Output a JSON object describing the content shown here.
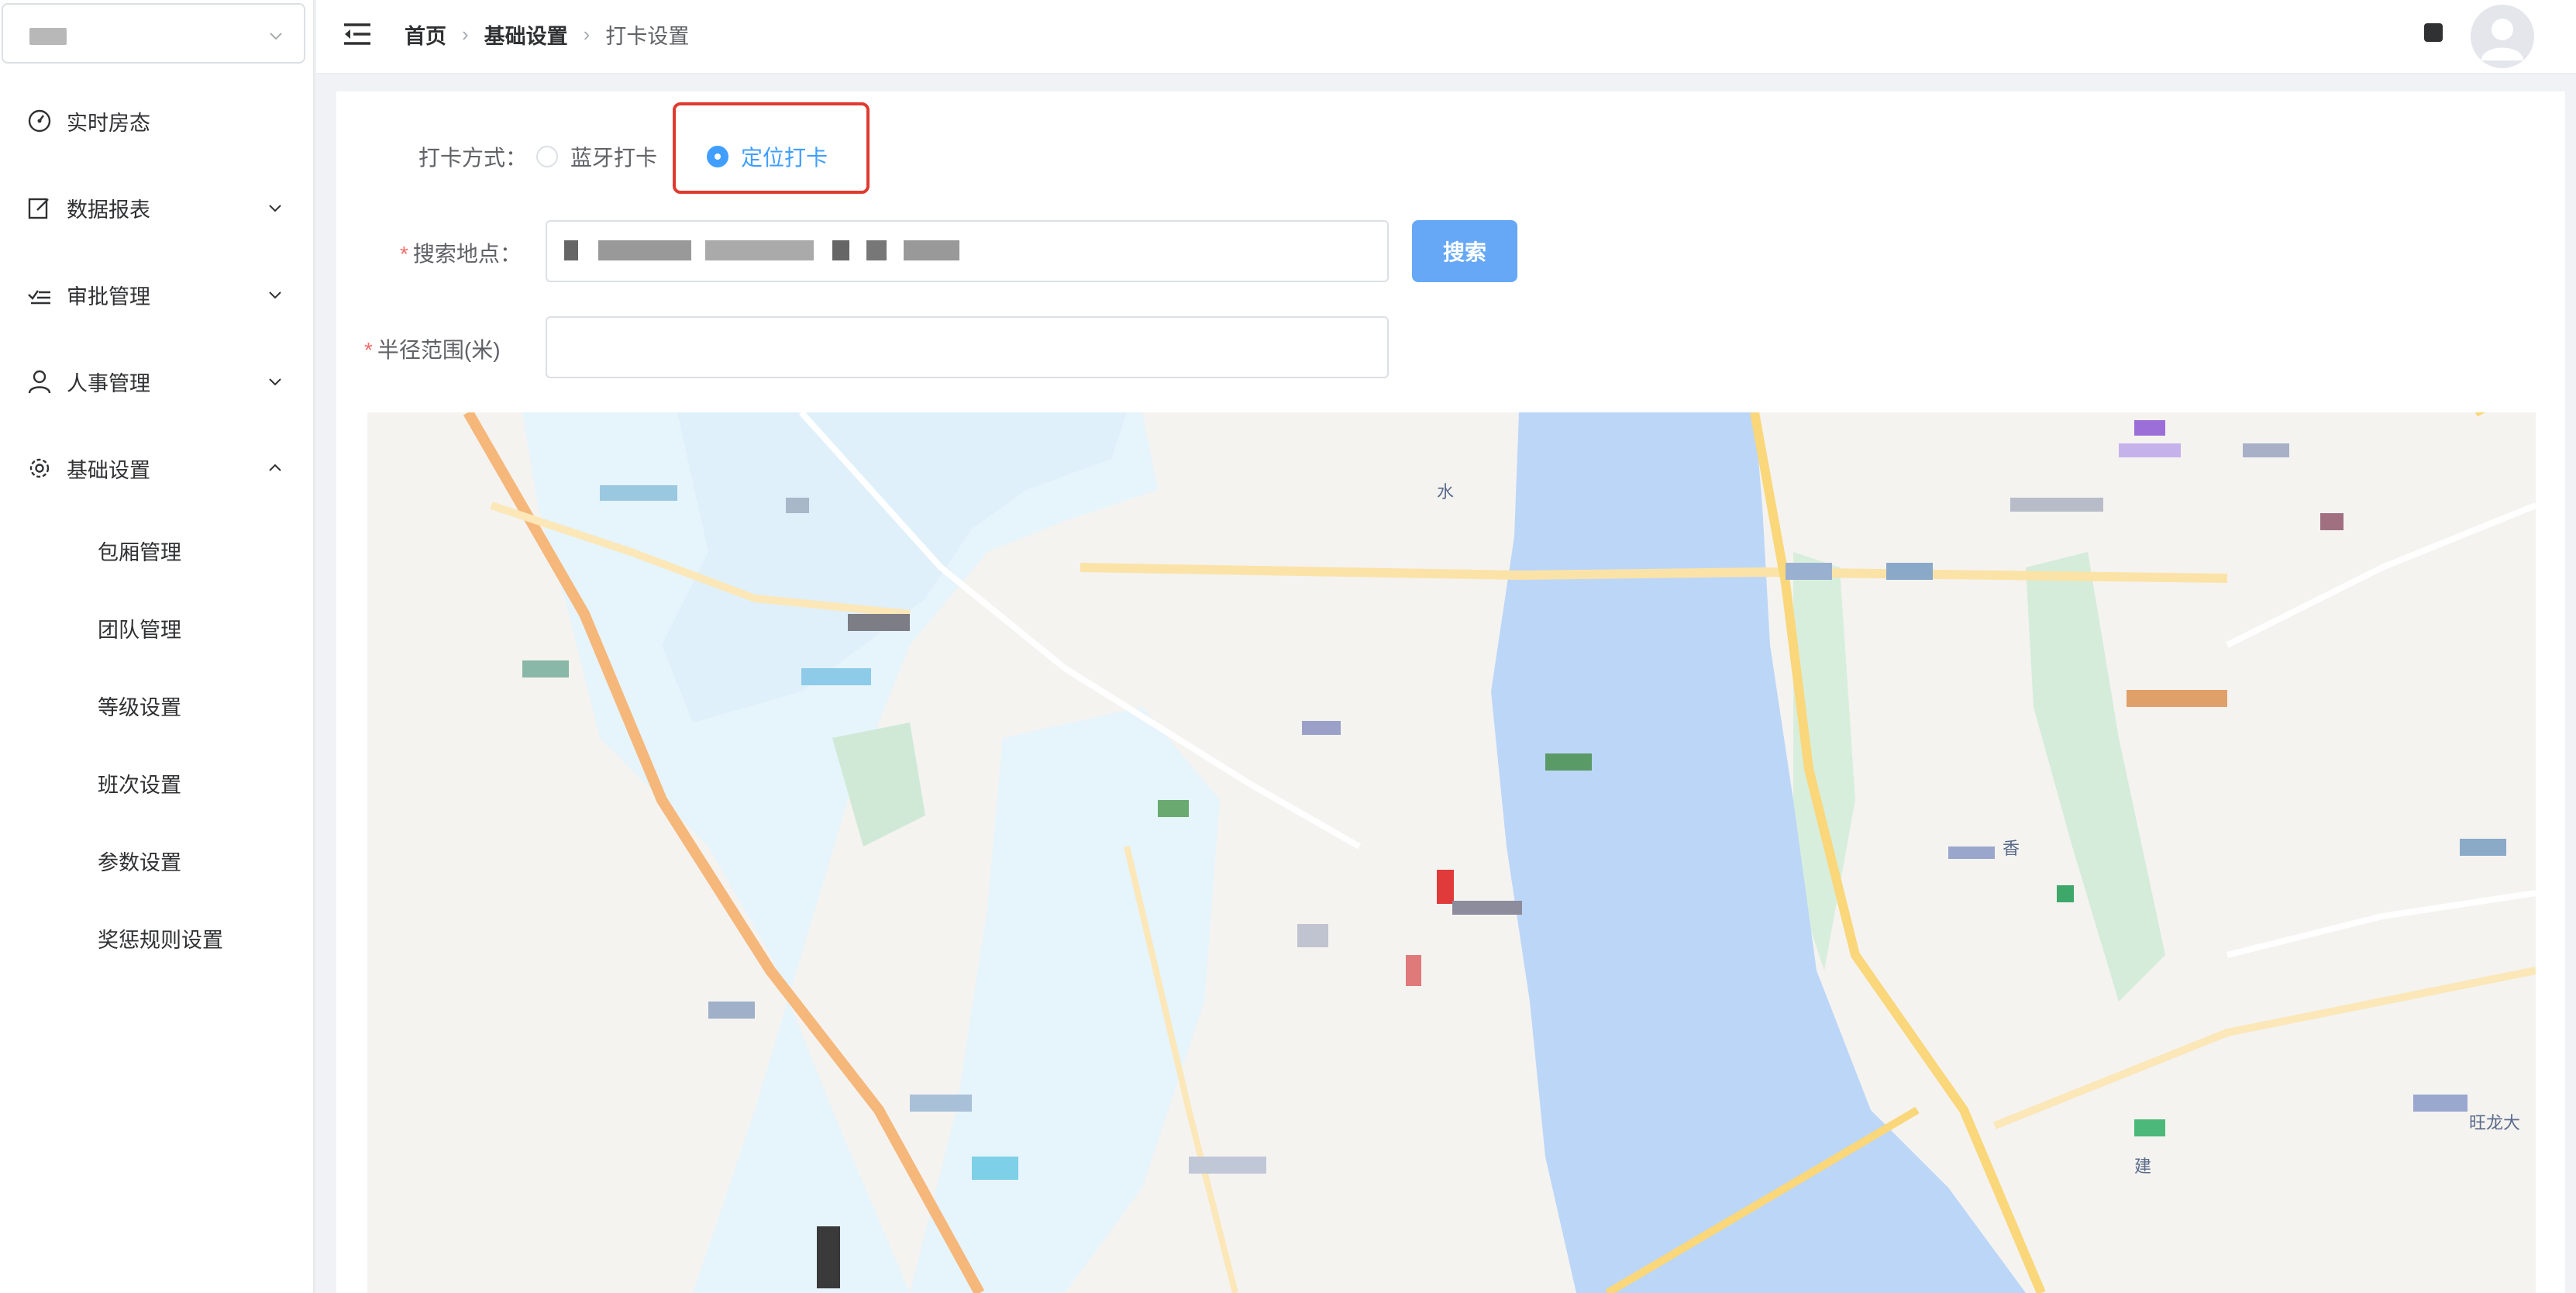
{
  "sidebar": {
    "org_select": {
      "value": ""
    },
    "menu": [
      {
        "label": "实时房态",
        "icon": "dashboard-icon",
        "arrow": ""
      },
      {
        "label": "数据报表",
        "icon": "edit-icon",
        "arrow": "chevron-down-icon"
      },
      {
        "label": "审批管理",
        "icon": "checklist-icon",
        "arrow": "chevron-down-icon"
      },
      {
        "label": "人事管理",
        "icon": "user-icon",
        "arrow": "chevron-down-icon"
      },
      {
        "label": "基础设置",
        "icon": "gear-icon",
        "arrow": "chevron-up-icon"
      }
    ],
    "sub_menu": [
      {
        "label": "包厢管理"
      },
      {
        "label": "团队管理"
      },
      {
        "label": "等级设置"
      },
      {
        "label": "班次设置"
      },
      {
        "label": "参数设置"
      },
      {
        "label": "奖惩规则设置"
      }
    ]
  },
  "header": {
    "breadcrumb": [
      "首页",
      "基础设置",
      "打卡设置"
    ]
  },
  "form": {
    "checkin_method_label": "打卡方式：",
    "options": [
      {
        "label": "蓝牙打卡",
        "checked": false
      },
      {
        "label": "定位打卡",
        "checked": true
      }
    ],
    "search_label": "搜索地点：",
    "search_value": "",
    "search_button": "搜索",
    "radius_label": "半径范围(米)",
    "radius_value": ""
  },
  "map": {
    "labels": [
      "水",
      "香",
      "建",
      "旺龙大"
    ]
  },
  "colors": {
    "primary": "#409eff",
    "highlight": "#e03a2f",
    "required": "#f56c6c",
    "water": "#bcd6f7",
    "green": "#d4ecd9"
  }
}
